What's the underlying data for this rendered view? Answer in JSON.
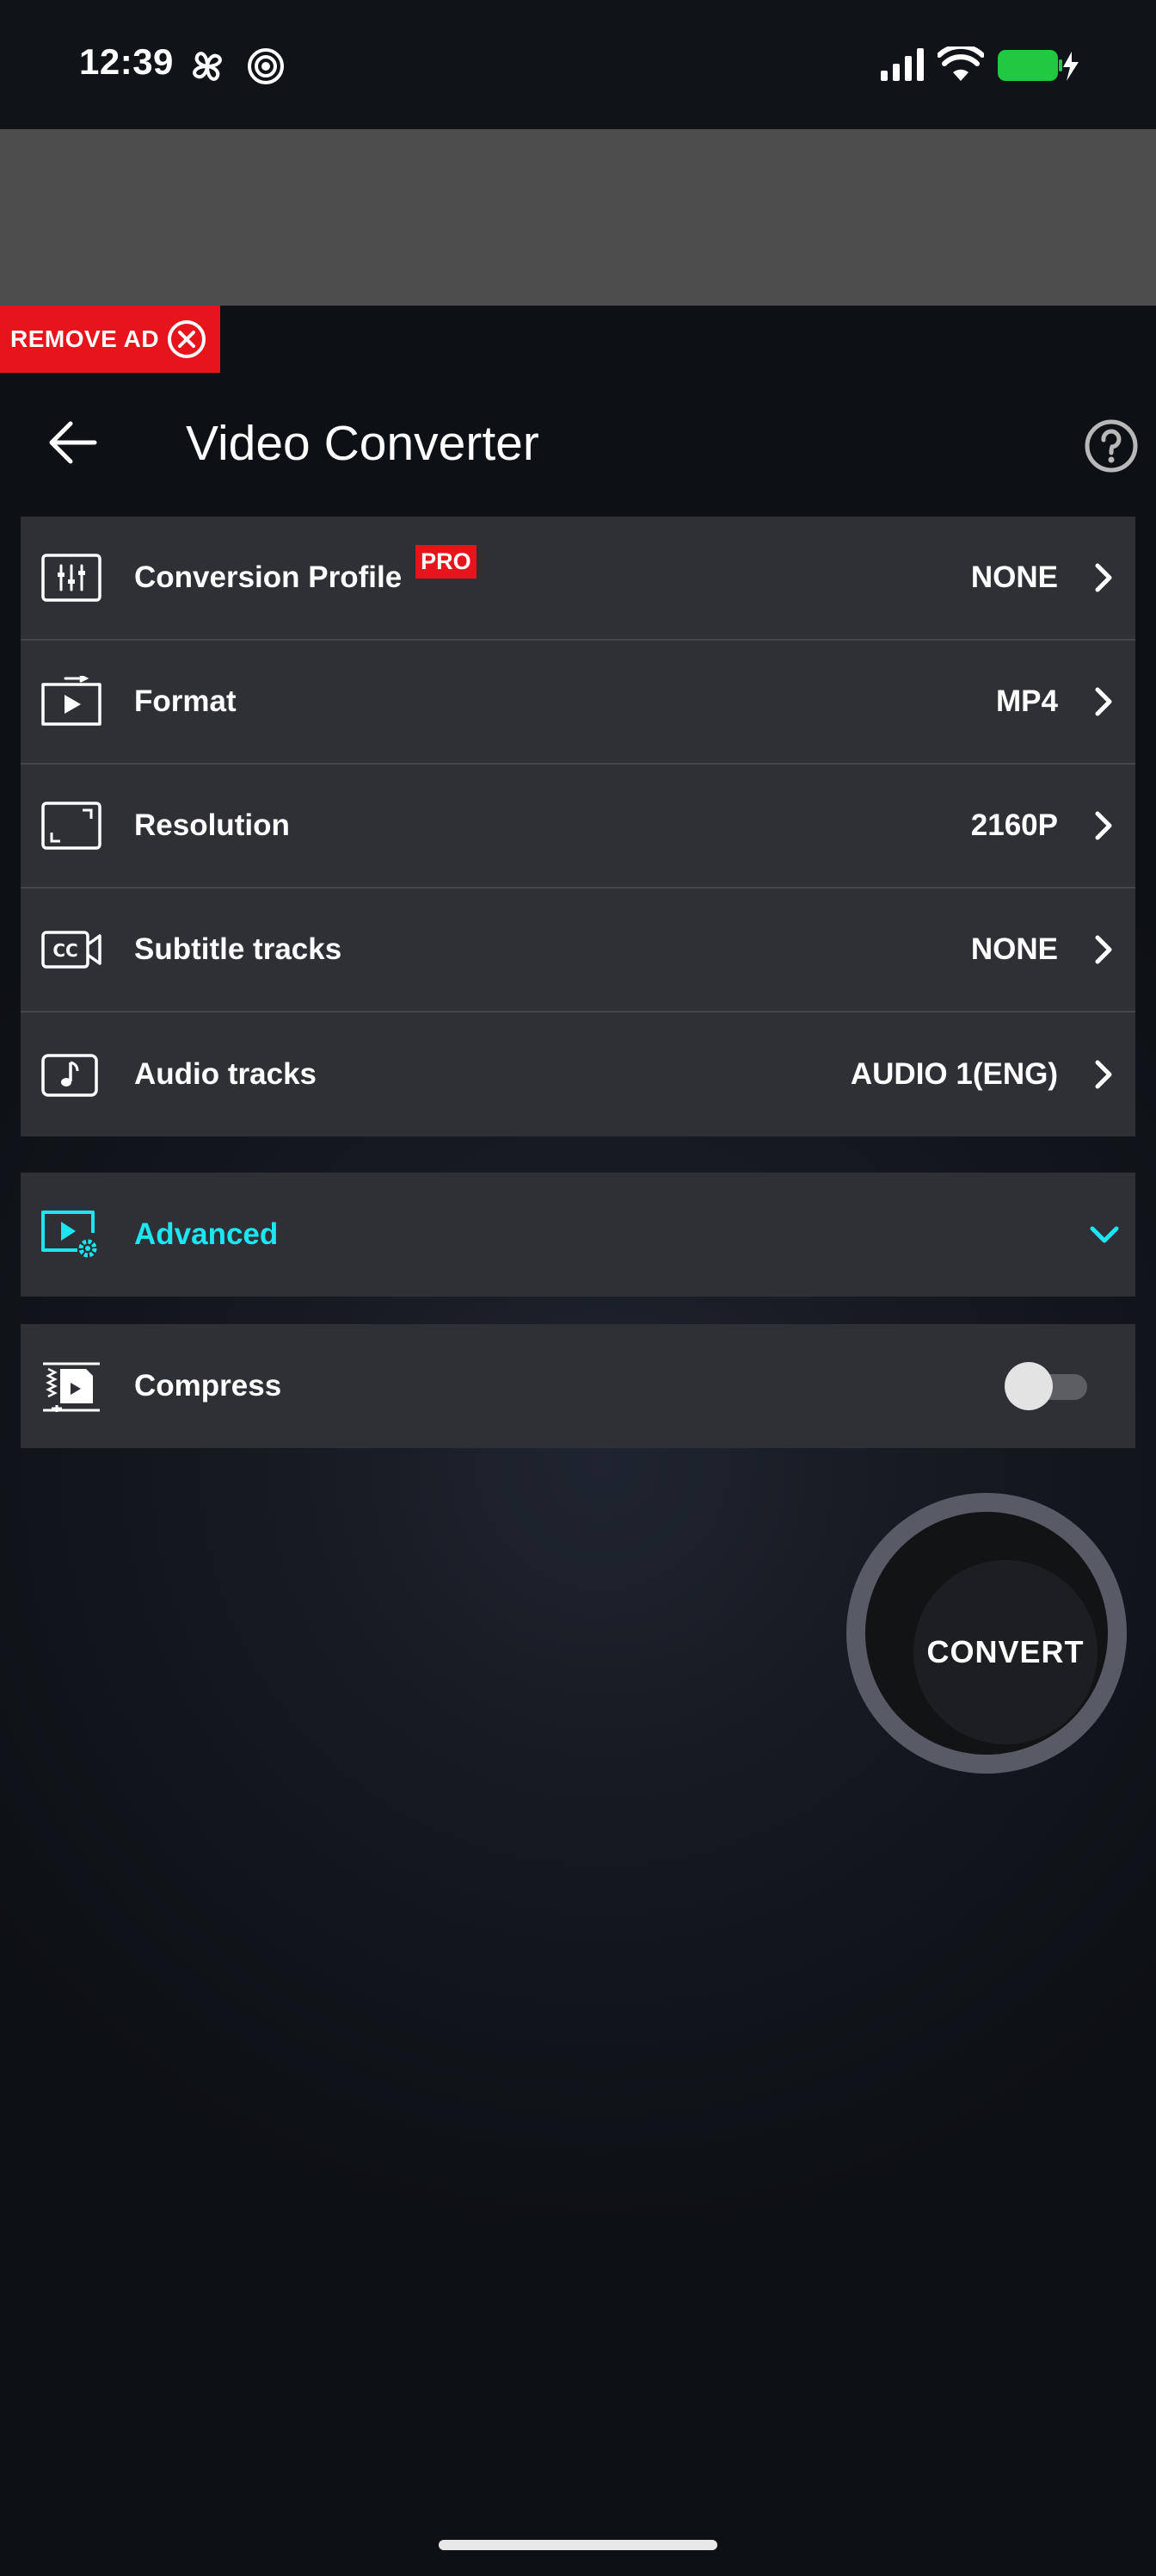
{
  "status_bar": {
    "time": "12:39",
    "icons": [
      "pinwheel-icon",
      "spiral-icon",
      "signal-icon",
      "wifi-icon",
      "battery-charging-icon"
    ],
    "battery_color": "#21c842"
  },
  "ad": {
    "remove_label": "REMOVE AD",
    "remove_color": "#e8141b"
  },
  "header": {
    "title": "Video Converter"
  },
  "settings": {
    "conversion_profile": {
      "label": "Conversion Profile",
      "badge": "PRO",
      "value": "NONE"
    },
    "format": {
      "label": "Format",
      "value": "MP4"
    },
    "resolution": {
      "label": "Resolution",
      "value": "2160P"
    },
    "subtitle_tracks": {
      "label": "Subtitle tracks",
      "value": "NONE"
    },
    "audio_tracks": {
      "label": "Audio tracks",
      "value": "AUDIO 1(ENG)"
    }
  },
  "advanced": {
    "label": "Advanced",
    "accent_color": "#1ce6f2"
  },
  "compress": {
    "label": "Compress",
    "enabled": false
  },
  "convert_button": {
    "label": "CONVERT"
  }
}
